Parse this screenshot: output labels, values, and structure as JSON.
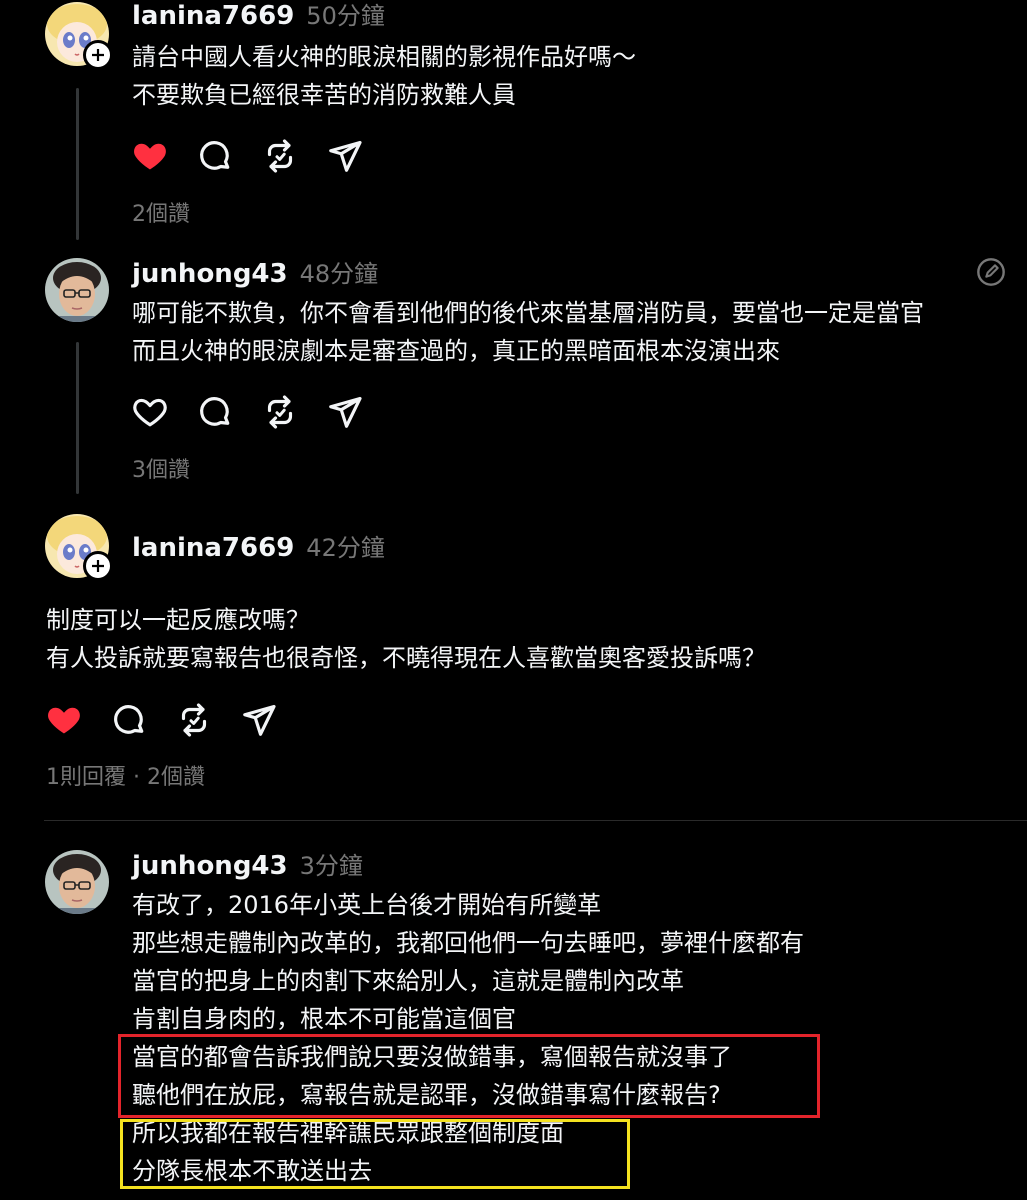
{
  "colors": {
    "background": "#000000",
    "text": "#f3f5f7",
    "muted": "#777777",
    "like_active": "#ff3040",
    "highlight_red": "#e3242b",
    "highlight_yellow": "#f4e21f"
  },
  "posts": [
    {
      "username": "lanina7669",
      "time": "50分鐘",
      "lines": [
        "請台中國人看火神的眼淚相關的影視作品好嗎～",
        "不要欺負已經很幸苦的消防救難人員"
      ],
      "liked": true,
      "meta": "2個讚"
    },
    {
      "username": "junhong43",
      "time": "48分鐘",
      "lines": [
        "哪可能不欺負，你不會看到他們的後代來當基層消防員，要當也一定是當官",
        "而且火神的眼淚劇本是審查過的，真正的黑暗面根本沒演出來"
      ],
      "liked": false,
      "meta": "3個讚"
    },
    {
      "username": "lanina7669",
      "time": "42分鐘",
      "lines": [
        "制度可以一起反應改嗎？",
        "有人投訴就要寫報告也很奇怪，不曉得現在人喜歡當奧客愛投訴嗎？"
      ],
      "liked": true,
      "meta": "1則回覆 · 2個讚"
    },
    {
      "username": "junhong43",
      "time": "3分鐘",
      "lines": [
        "有改了，2016年小英上台後才開始有所變革",
        "那些想走體制內改革的，我都回他們一句去睡吧，夢裡什麼都有",
        "當官的把身上的肉割下來給別人，這就是體制內改革",
        "肯割自身肉的，根本不可能當這個官",
        "當官的都會告訴我們說只要沒做錯事，寫個報告就沒事了",
        "聽他們在放屁，寫報告就是認罪，沒做錯事寫什麼報告?",
        "所以我都在報告裡幹譙民眾跟整個制度面",
        "分隊長根本不敢送出去"
      ]
    }
  ]
}
